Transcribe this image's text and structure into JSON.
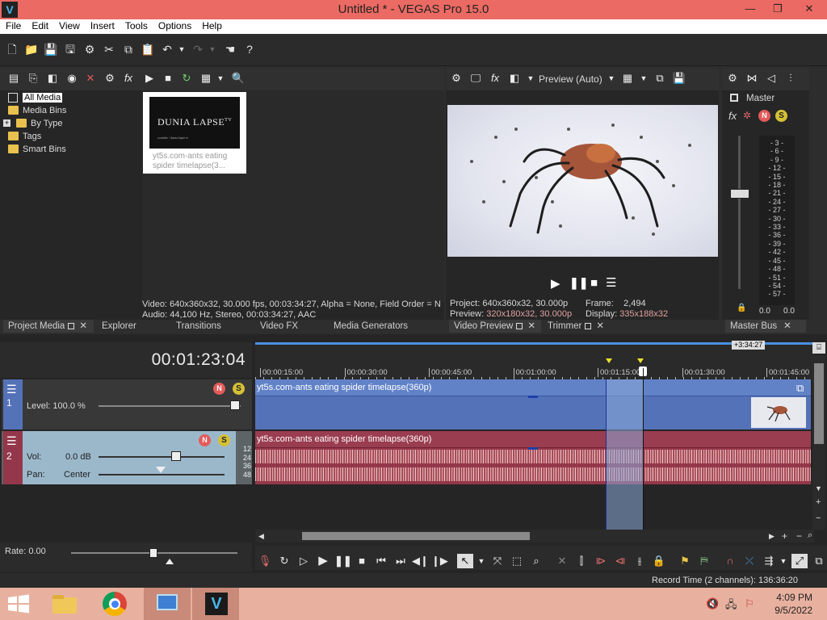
{
  "window": {
    "title": "Untitled * - VEGAS Pro 15.0",
    "logo": "V",
    "minimize": "—",
    "restore": "❐",
    "close": "✕"
  },
  "menu": [
    "File",
    "Edit",
    "View",
    "Insert",
    "Tools",
    "Options",
    "Help"
  ],
  "media_tree": {
    "items": [
      "All Media",
      "Media Bins",
      "By Type",
      "Tags",
      "Smart Bins"
    ],
    "expander": "+"
  },
  "media_thumb": {
    "brand": "DUNIA LAPSE",
    "tm": "TV",
    "sub": "youtube / dunia lapse tv",
    "caption": "yt5s.com-ants eating spider timelapse(3..."
  },
  "media_info": {
    "video": "Video: 640x360x32, 30.000 fps, 00:03:34:27, Alpha = None, Field Order = N",
    "audio": "Audio: 44,100 Hz, Stereo, 00:03:34:27, AAC"
  },
  "left_tabs": [
    "Project Media",
    "Explorer",
    "Transitions",
    "Video FX",
    "Media Generators"
  ],
  "preview": {
    "mode": "Preview (Auto)",
    "project_label": "Project:",
    "project_value": "640x360x32, 30.000p",
    "preview_label": "Preview:",
    "preview_value": "320x180x32, 30.000p",
    "frame_label": "Frame:",
    "frame_value": "2,494",
    "display_label": "Display:",
    "display_value": "335x188x32"
  },
  "preview_tabs": [
    "Video Preview",
    "Trimmer"
  ],
  "master": {
    "label": "Master",
    "tab": "Master Bus",
    "scale": [
      "3",
      "6",
      "9",
      "12",
      "15",
      "18",
      "21",
      "24",
      "27",
      "30",
      "33",
      "36",
      "39",
      "42",
      "45",
      "48",
      "51",
      "54",
      "57"
    ],
    "left_db": "0.0",
    "right_db": "0.0"
  },
  "timeline": {
    "timecode": "00:01:23:04",
    "length_badge": "+3:34:27",
    "ruler": [
      "00:00:15:00",
      "00:00:30:00",
      "00:00:45:00",
      "00:01:00:00",
      "00:01:15:00",
      "00:01:30:00",
      "00:01:45:00"
    ]
  },
  "video_track": {
    "number": "1",
    "level": "Level: 100.0 %",
    "clip": "yt5s.com-ants eating spider timelapse(360p)"
  },
  "audio_track": {
    "number": "2",
    "vol_label": "Vol:",
    "vol_value": "0.0 dB",
    "pan_label": "Pan:",
    "pan_value": "Center",
    "scale": [
      "12",
      "24",
      "36",
      "48"
    ],
    "clip": "yt5s.com-ants eating spider timelapse(360p)"
  },
  "rate": "Rate: 0.00",
  "status": "Record Time (2 channels): 136:36:20",
  "taskbar": {
    "time": "4:09 PM",
    "date": "9/5/2022"
  },
  "colors": {
    "titlebar": "#eb6a63",
    "video_track": "#5472b8",
    "audio_track": "#94374a",
    "selection": "#8aa9d8",
    "accent": "#4a90e2"
  }
}
